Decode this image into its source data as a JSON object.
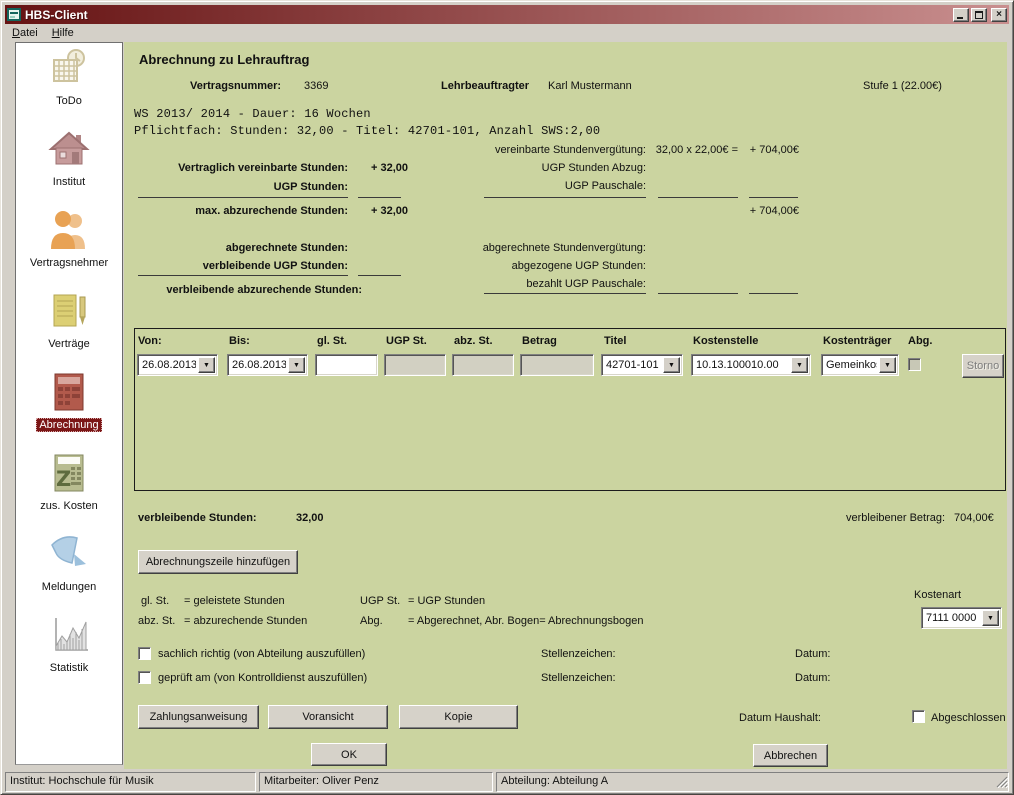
{
  "window": {
    "title": "HBS-Client"
  },
  "menu": {
    "items": [
      {
        "hotkey": "D",
        "rest": "atei"
      },
      {
        "hotkey": "H",
        "rest": "ilfe"
      }
    ]
  },
  "sidebar": {
    "items": [
      {
        "label": "ToDo"
      },
      {
        "label": "Institut"
      },
      {
        "label": "Vertragsnehmer"
      },
      {
        "label": "Verträge"
      },
      {
        "label": "Abrechnung",
        "selected": true
      },
      {
        "label": "zus. Kosten"
      },
      {
        "label": "Meldungen"
      },
      {
        "label": "Statistik"
      }
    ]
  },
  "header": {
    "title": "Abrechnung zu Lehrauftrag",
    "vertragsnummer_label": "Vertragsnummer:",
    "vertragsnummer_value": "3369",
    "lehrbeauftragter_label": "Lehrbeauftragter",
    "lehrbeauftragter_value": "Karl Mustermann",
    "stufe": "Stufe 1 (22.00€)"
  },
  "info": {
    "line1": "WS 2013/ 2014 - Dauer: 16 Wochen",
    "line2": "Pflichtfach: Stunden: 32,00 - Titel: 42701-101, Anzahl SWS:2,00"
  },
  "calc": {
    "left": [
      {
        "label": "Vertraglich vereinbarte Stunden:",
        "value": "+ 32,00"
      },
      {
        "label": "UGP Stunden:",
        "value": ""
      },
      {
        "label": "max. abzurechende Stunden:",
        "value": "+ 32,00"
      },
      {
        "label": "abgerechnete Stunden:",
        "value": ""
      },
      {
        "label": "verbleibende UGP Stunden:",
        "value": ""
      },
      {
        "label": "verbleibende abzurechende Stunden:",
        "value": ""
      }
    ],
    "right": [
      {
        "label": "vereinbarte Stundenvergütung:",
        "calc": "32,00 x 22,00€ =",
        "value": "+ 704,00€"
      },
      {
        "label": "UGP Stunden Abzug:",
        "calc": "",
        "value": ""
      },
      {
        "label": "UGP Pauschale:",
        "calc": "",
        "value": ""
      },
      {
        "label": "",
        "calc": "",
        "value": "+ 704,00€"
      },
      {
        "label": "abgerechnete Stundenvergütung:",
        "calc": "",
        "value": ""
      },
      {
        "label": "abgezogene UGP Stunden:",
        "calc": "",
        "value": ""
      },
      {
        "label": "bezahlt UGP Pauschale:",
        "calc": "",
        "value": ""
      }
    ]
  },
  "grid": {
    "columns": [
      "Von:",
      "Bis:",
      "gl. St.",
      "UGP St.",
      "abz. St.",
      "Betrag",
      "Titel",
      "Kostenstelle",
      "Kostenträger",
      "Abg."
    ],
    "row": {
      "von": "26.08.2013",
      "bis": "26.08.2013",
      "gl_st": "",
      "ugp_st": "",
      "abz_st": "",
      "betrag": "",
      "titel": "42701-101",
      "kostenstelle": "10.13.100010.00",
      "kostentraeger": "Gemeinkosten",
      "abg_checked": false
    },
    "storno_label": "Storno"
  },
  "summary": {
    "hours_label": "verbleibende Stunden:",
    "hours_value": "32,00",
    "amount_label": "verbleibener Betrag:",
    "amount_value": "704,00€"
  },
  "buttons": {
    "add_row": "Abrechnungszeile hinzufügen",
    "zahlungsanweisung": "Zahlungsanweisung",
    "voransicht": "Voransicht",
    "kopie": "Kopie",
    "ok": "OK",
    "abbrechen": "Abbrechen"
  },
  "legend": {
    "rows": [
      {
        "abbr1": "gl. St.",
        "def1": "= geleistete Stunden",
        "abbr2": "UGP St.",
        "def2": "= UGP Stunden"
      },
      {
        "abbr1": "abz. St.",
        "def1": "= abzurechende Stunden",
        "abbr2": "Abg.",
        "def2": "= Abgerechnet,  Abr. Bogen= Abrechnungsbogen"
      }
    ]
  },
  "kostenart": {
    "label": "Kostenart",
    "value": "7111 0000"
  },
  "approval": {
    "rows": [
      {
        "checkbox_label": "sachlich richtig (von Abteilung auszufüllen)",
        "stellenzeichen_label": "Stellenzeichen:",
        "datum_label": "Datum:",
        "checked": false
      },
      {
        "checkbox_label": "geprüft am (von Kontrolldienst auszufüllen)",
        "stellenzeichen_label": "Stellenzeichen:",
        "datum_label": "Datum:",
        "checked": false
      }
    ],
    "datum_haushalt_label": "Datum Haushalt:",
    "abgeschlossen_label": "Abgeschlossen",
    "abgeschlossen_checked": false
  },
  "statusbar": {
    "panels": [
      {
        "text": "Institut: Hochschule für Musik"
      },
      {
        "text": "Mitarbeiter: Oliver Penz"
      },
      {
        "text": "Abteilung: Abteilung A"
      }
    ]
  },
  "colors": {
    "titlebar_dark": "#661313",
    "titlebar_light": "#c98f8f",
    "content_bg": "#cbd4a0",
    "chrome": "#d4d0c8",
    "highlight": "#7b1616"
  }
}
